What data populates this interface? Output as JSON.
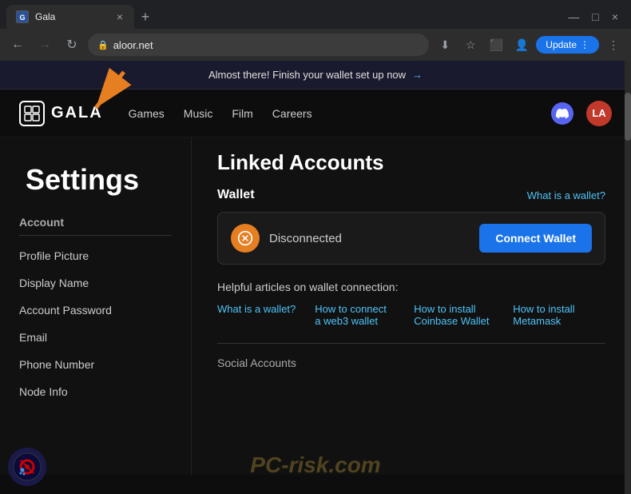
{
  "browser": {
    "tab": {
      "favicon": "G",
      "title": "Gala",
      "close_label": "×",
      "new_tab_label": "+"
    },
    "window_controls": {
      "minimize": "—",
      "maximize": "□",
      "close": "×"
    },
    "nav": {
      "back": "←",
      "forward": "→",
      "refresh": "↻"
    },
    "address": "aloor.net",
    "lock_icon": "🔒",
    "update_button": "Update",
    "toolbar_icons": [
      "⬇",
      "★",
      "□",
      "👤",
      "⋮"
    ]
  },
  "site": {
    "banner": {
      "text": "Almost there! Finish your wallet set up now",
      "arrow": "→"
    },
    "nav": {
      "logo_text": "GALA",
      "links": [
        "Games",
        "Music",
        "Film",
        "Careers"
      ],
      "user_avatar": "LA"
    },
    "settings": {
      "page_title": "Settings",
      "sidebar": {
        "section_label": "Account",
        "items": [
          "Profile Picture",
          "Display Name",
          "Account Password",
          "Email",
          "Phone Number",
          "Node Info"
        ]
      },
      "linked_accounts": {
        "title": "Linked Accounts",
        "wallet_label": "Wallet",
        "what_is_wallet": "What is a wallet?",
        "wallet_status": "Disconnected",
        "connect_button": "Connect Wallet",
        "helpful_title": "Helpful articles on wallet connection:",
        "helpful_links": [
          "What is a wallet?",
          "How to connect a web3 wallet",
          "How to install Coinbase Wallet",
          "How to install Metamask"
        ]
      },
      "social_accounts_label": "Social Accounts"
    }
  },
  "watermark": "PC-risk.com",
  "annotation": {
    "arrow_color": "#e67e22"
  }
}
